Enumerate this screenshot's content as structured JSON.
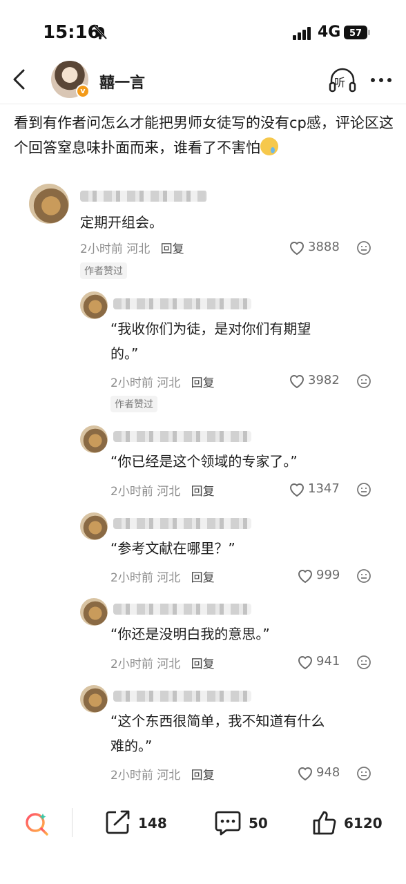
{
  "status_bar": {
    "time": "15:16",
    "network": "4G",
    "battery": "57"
  },
  "nav": {
    "author_name": "囍一言",
    "listen_label": "听"
  },
  "post": {
    "text": "看到有作者问怎么才能把男师女徒写的没有cp感，评论区这个回答窒息味扑面而来，谁看了不害怕",
    "emoji": "crying-face"
  },
  "comments": [
    {
      "text": "定期开组会。",
      "time": "2小时前",
      "location": "河北",
      "reply_label": "回复",
      "likes": "3888",
      "tag": "作者赞过"
    },
    {
      "text": "“我收你们为徒，是对你们有期望",
      "text2": "的。”",
      "time": "2小时前",
      "location": "河北",
      "reply_label": "回复",
      "likes": "3982",
      "tag": "作者赞过"
    },
    {
      "text": "“你已经是这个领域的专家了。”",
      "time": "2小时前",
      "location": "河北",
      "reply_label": "回复",
      "likes": "1347"
    },
    {
      "text": "“参考文献在哪里？”",
      "time": "2小时前",
      "location": "河北",
      "reply_label": "回复",
      "likes": "999"
    },
    {
      "text": "“你还是没明白我的意思。”",
      "time": "2小时前",
      "location": "河北",
      "reply_label": "回复",
      "likes": "941"
    },
    {
      "text": "“这个东西很简单，我不知道有什么",
      "text2": "难的。”",
      "time": "2小时前",
      "location": "河北",
      "reply_label": "回复",
      "likes": "948"
    }
  ],
  "bottom_bar": {
    "share_count": "148",
    "comment_count": "50",
    "like_count": "6120"
  },
  "colors": {
    "badge": "#f39a18",
    "text": "#1a1a1a",
    "meta": "#8d8d8d"
  }
}
